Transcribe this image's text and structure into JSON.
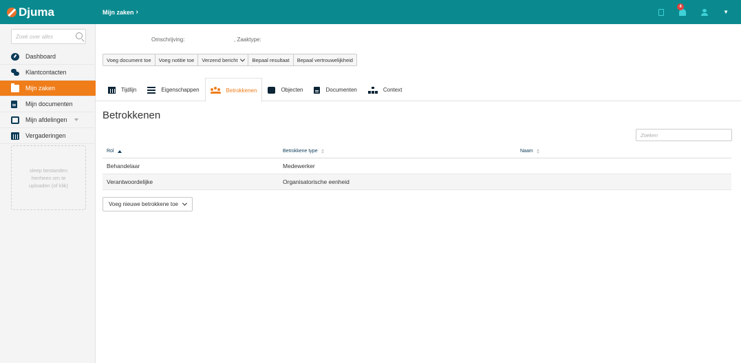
{
  "header": {
    "brand": "Djuma",
    "breadcrumb": "Mijn zaken",
    "notification_count": "4"
  },
  "sidebar": {
    "search_placeholder": "Zoek over alles",
    "items": [
      {
        "label": "Dashboard"
      },
      {
        "label": "Klantcontacten"
      },
      {
        "label": "Mijn zaken"
      },
      {
        "label": "Mijn documenten"
      },
      {
        "label": "Mijn afdelingen"
      },
      {
        "label": "Vergaderingen"
      }
    ],
    "dropzone_text": "sleep bestanden hierheen om te uploaden (of klik)"
  },
  "case": {
    "omschrijving_label": "Omschrijving:",
    "zaaktype_label": ", Zaaktype:"
  },
  "actions": {
    "add_document": "Voeg document toe",
    "add_note": "Voeg notitie toe",
    "send_message": "Verzend bericht",
    "set_result": "Bepaal resultaat",
    "set_confidentiality": "Bepaal vertrouwelijkheid"
  },
  "tabs": [
    {
      "label": "Tijdlijn"
    },
    {
      "label": "Eigenschappen"
    },
    {
      "label": "Betrokkenen"
    },
    {
      "label": "Objecten"
    },
    {
      "label": "Documenten"
    },
    {
      "label": "Context"
    }
  ],
  "page_title": "Betrokkenen",
  "table": {
    "search_placeholder": "Zoeken",
    "columns": [
      "Rol",
      "Betrokkene type",
      "Naam"
    ],
    "rows": [
      [
        "Behandelaar",
        "Medewerker",
        ""
      ],
      [
        "Verantwoordelijke",
        "Organisatorische eenheid",
        ""
      ]
    ]
  },
  "add_party_button": "Voeg nieuwe betrokkene toe",
  "colors": {
    "topbar": "#0a8a8f",
    "accent": "#ef7d1a",
    "icon_dark": "#0b2436"
  }
}
